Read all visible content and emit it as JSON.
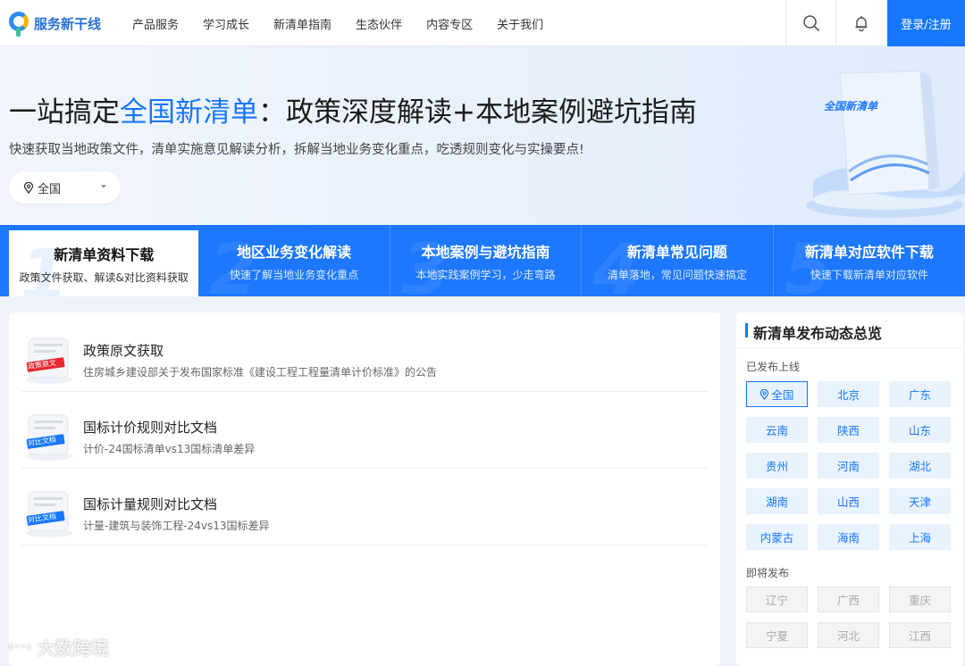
{
  "header": {
    "logo_text": "服务新干线",
    "nav": [
      "产品服务",
      "学习成长",
      "新清单指南",
      "生态伙伴",
      "内容专区",
      "关于我们"
    ],
    "login_label": "登录/注册"
  },
  "hero": {
    "title_prefix": "一站搞定",
    "title_highlight": "全国新清单",
    "title_suffix": "：政策深度解读+本地案例避坑指南",
    "subtitle": "快速获取当地政策文件，清单实施意见解读分析，拆解当地业务变化重点，吃透规则变化与实操要点!",
    "region_value": "全国",
    "book_label": "全国新清单"
  },
  "tabs": [
    {
      "num": "1",
      "title": "新清单资料下载",
      "desc": "政策文件获取、解读&对比资料获取",
      "active": true
    },
    {
      "num": "2",
      "title": "地区业务变化解读",
      "desc": "快速了解当地业务变化重点",
      "active": false
    },
    {
      "num": "3",
      "title": "本地案例与避坑指南",
      "desc": "本地实践案例学习，少走弯路",
      "active": false
    },
    {
      "num": "4",
      "title": "新清单常见问题",
      "desc": "清单落地，常见问题快速搞定",
      "active": false
    },
    {
      "num": "5",
      "title": "新清单对应软件下载",
      "desc": "快速下载新清单对应软件",
      "active": false
    }
  ],
  "list": [
    {
      "title": "政策原文获取",
      "desc": "住房城乡建设部关于发布国家标准《建设工程工程量清单计价标准》的公告",
      "tag": "政策原文",
      "tag_color": "#e8262f"
    },
    {
      "title": "国标计价规则对比文档",
      "desc": "计价-24国标清单vs13国标清单差异",
      "tag": "对比文档",
      "tag_color": "#1677ff"
    },
    {
      "title": "国标计量规则对比文档",
      "desc": "计量-建筑与装饰工程-24vs13国标差异",
      "tag": "对比文档",
      "tag_color": "#1677ff"
    }
  ],
  "sidebar": {
    "title": "新清单发布动态总览",
    "published_label": "已发布上线",
    "published": [
      "全国",
      "北京",
      "广东",
      "云南",
      "陕西",
      "山东",
      "贵州",
      "河南",
      "湖北",
      "湖南",
      "山西",
      "天津",
      "内蒙古",
      "海南",
      "上海"
    ],
    "upcoming_label": "即将发布",
    "upcoming": [
      "辽宁",
      "广西",
      "重庆",
      "宁夏",
      "河北",
      "江西"
    ]
  },
  "watermark": "大数跨境",
  "colors": {
    "brand": "#1677ff",
    "tab_bg": "#1d78ff",
    "tag_red": "#e8262f"
  }
}
